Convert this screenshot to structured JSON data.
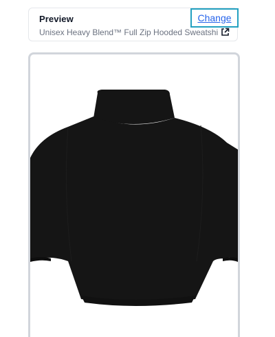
{
  "preview": {
    "title": "Preview",
    "change_label": "Change",
    "product_name": "Unisex Heavy Blend™ Full Zip Hooded Sweatshirt -...",
    "external_link_icon": "external-link-icon"
  },
  "product_image": {
    "subject": "hoodie-back-view",
    "color": "#141414"
  }
}
